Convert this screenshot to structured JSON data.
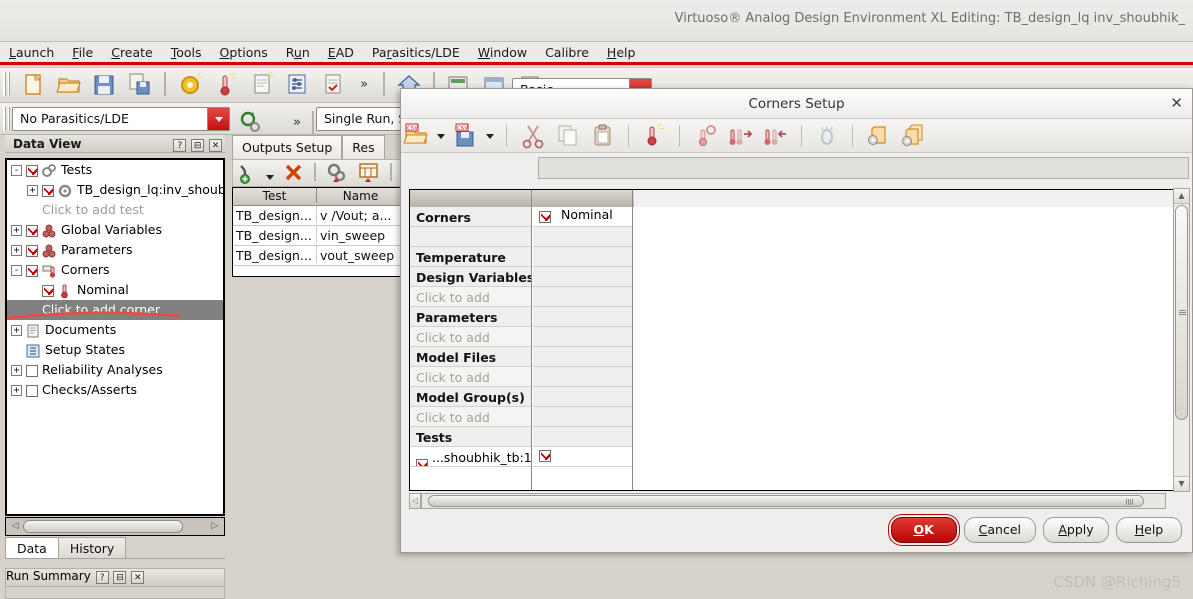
{
  "window": {
    "title": "Virtuoso® Analog Design Environment XL Editing: TB_design_lq inv_shoubhik_",
    "menus": [
      {
        "label": "Launch",
        "accel": "L"
      },
      {
        "label": "File",
        "accel": "F"
      },
      {
        "label": "Create",
        "accel": "C"
      },
      {
        "label": "Tools",
        "accel": "T"
      },
      {
        "label": "Options",
        "accel": "O"
      },
      {
        "label": "Run",
        "accel": "u"
      },
      {
        "label": "EAD",
        "accel": "E"
      },
      {
        "label": "Parasitics/LDE",
        "accel": "r"
      },
      {
        "label": "Window",
        "accel": "W"
      },
      {
        "label": "Calibre",
        "accel": ""
      },
      {
        "label": "Help",
        "accel": "H"
      }
    ]
  },
  "toolbar": {
    "icons": [
      "new-file-icon",
      "open-folder-icon",
      "save-icon",
      "save-as-icon",
      "gear-setup-icon",
      "thermometer-corner-icon",
      "new-document-icon",
      "variables-icon",
      "checks-icon"
    ],
    "overflow_label": "»",
    "home_icon": "home-icon",
    "extra_icons": [
      "results-browser-icon",
      "waveform-icon",
      "annotate-icon"
    ]
  },
  "toolbar2": {
    "parasitics_value": "No Parasitics/LDE",
    "parasitics_overflow": "»",
    "run_mode_value": "Single Run, Sw",
    "mode_value": "Basic",
    "refresh_icon": "refresh-gear-icon"
  },
  "data_view": {
    "title": "Data View",
    "header_buttons": [
      "?",
      "⊟",
      "✕"
    ],
    "tree": [
      {
        "label": "Tests",
        "expander": "-",
        "checked": true,
        "icon": "tests-gear-icon",
        "indent": 0
      },
      {
        "label": "TB_design_lq:inv_shoubh.",
        "expander": "+",
        "checked": true,
        "icon": "test-gear-icon",
        "indent": 1
      },
      {
        "label": "Click to add test",
        "expander": "",
        "checked": null,
        "icon": "",
        "indent": 1,
        "dim": true
      },
      {
        "label": "Global Variables",
        "expander": "+",
        "checked": true,
        "icon": "variables-icon",
        "indent": 0
      },
      {
        "label": "Parameters",
        "expander": "+",
        "checked": true,
        "icon": "parameters-icon",
        "indent": 0
      },
      {
        "label": "Corners",
        "expander": "-",
        "checked": true,
        "icon": "corners-icon",
        "indent": 0
      },
      {
        "label": "Nominal",
        "expander": "",
        "checked": true,
        "icon": "thermometer-icon",
        "indent": 1
      },
      {
        "label": "Click to add corner",
        "expander": "",
        "checked": null,
        "icon": "",
        "indent": 1,
        "selected": true
      },
      {
        "label": "Documents",
        "expander": "+",
        "checked": null,
        "icon": "documents-icon",
        "indent": 0
      },
      {
        "label": "Setup States",
        "expander": "",
        "checked": null,
        "icon": "setup-states-icon",
        "indent": 0
      },
      {
        "label": "Reliability Analyses",
        "expander": "+",
        "checked": false,
        "icon": "",
        "indent": 0
      },
      {
        "label": "Checks/Asserts",
        "expander": "+",
        "checked": false,
        "icon": "",
        "indent": 0
      }
    ],
    "tabs": [
      {
        "label": "Data",
        "active": true
      },
      {
        "label": "History",
        "active": false
      }
    ]
  },
  "outputs_pane": {
    "tabs": [
      {
        "label": "Outputs Setup",
        "active": true
      },
      {
        "label": "Res",
        "active": false
      }
    ],
    "toolbar_icons": [
      "add-expression-icon",
      "delete-icon",
      "setup-gear-icon",
      "table-icon",
      "edit-icon"
    ],
    "columns": [
      "Test",
      "Name"
    ],
    "rows": [
      {
        "test": "TB_design...",
        "name": "v /Vout; a..."
      },
      {
        "test": "TB_design...",
        "name": "vin_sweep"
      },
      {
        "test": "TB_design...",
        "name": "vout_sweep"
      }
    ]
  },
  "dialog": {
    "title": "Corners Setup",
    "close_label": "✕",
    "toolbar_icons": [
      "open-csv-icon",
      "save-csv-icon",
      "cut-icon",
      "copy-icon",
      "paste-icon",
      "add-corner-icon",
      "delete-corner-icon",
      "export-corners-icon",
      "import-corners-icon",
      "sweep-icon",
      "config-file-icon",
      "config-files-icon"
    ],
    "filter_value": "",
    "grid": {
      "column_header_a": "",
      "column_header_b": "",
      "rows": [
        {
          "label": "Corners",
          "type": "header",
          "cell": "Nominal",
          "cell_checked": true
        },
        {
          "label": "",
          "type": "blank",
          "cell": "",
          "cell_checked": null
        },
        {
          "label": "Temperature",
          "type": "header",
          "cell": "",
          "cell_checked": null
        },
        {
          "label": "Design Variables",
          "type": "header",
          "cell": "",
          "cell_checked": null
        },
        {
          "label": "Click to add",
          "type": "add",
          "cell": "",
          "cell_checked": null
        },
        {
          "label": "Parameters",
          "type": "header",
          "cell": "",
          "cell_checked": null
        },
        {
          "label": "Click to add",
          "type": "add",
          "cell": "",
          "cell_checked": null
        },
        {
          "label": "Model Files",
          "type": "header",
          "cell": "",
          "cell_checked": null
        },
        {
          "label": "Click to add",
          "type": "add",
          "cell": "",
          "cell_checked": null
        },
        {
          "label": "Model Group(s)",
          "type": "header",
          "cell": "",
          "cell_checked": null
        },
        {
          "label": "Click to add",
          "type": "add",
          "cell": "",
          "cell_checked": null
        },
        {
          "label": "Tests",
          "type": "header",
          "cell": "",
          "cell_checked": null
        },
        {
          "label": "...shoubhik_tb:1",
          "type": "test",
          "cell": "",
          "cell_checked": true,
          "row_checked": true
        }
      ]
    },
    "buttons": [
      {
        "label": "OK",
        "accel": "O",
        "primary": true
      },
      {
        "label": "Cancel",
        "accel": "C",
        "primary": false
      },
      {
        "label": "Apply",
        "accel": "A",
        "primary": false
      },
      {
        "label": "Help",
        "accel": "H",
        "primary": false
      }
    ]
  },
  "run_summary": {
    "title": "Run Summary",
    "header_buttons": [
      "?",
      "⊟",
      "✕"
    ]
  },
  "watermark": "CSDN @Riching5",
  "colors": {
    "accent_red": "#cc0000",
    "ok_button": "#b70606",
    "selection_gray": "#808080",
    "panel_bg": "#d6d2ca"
  }
}
